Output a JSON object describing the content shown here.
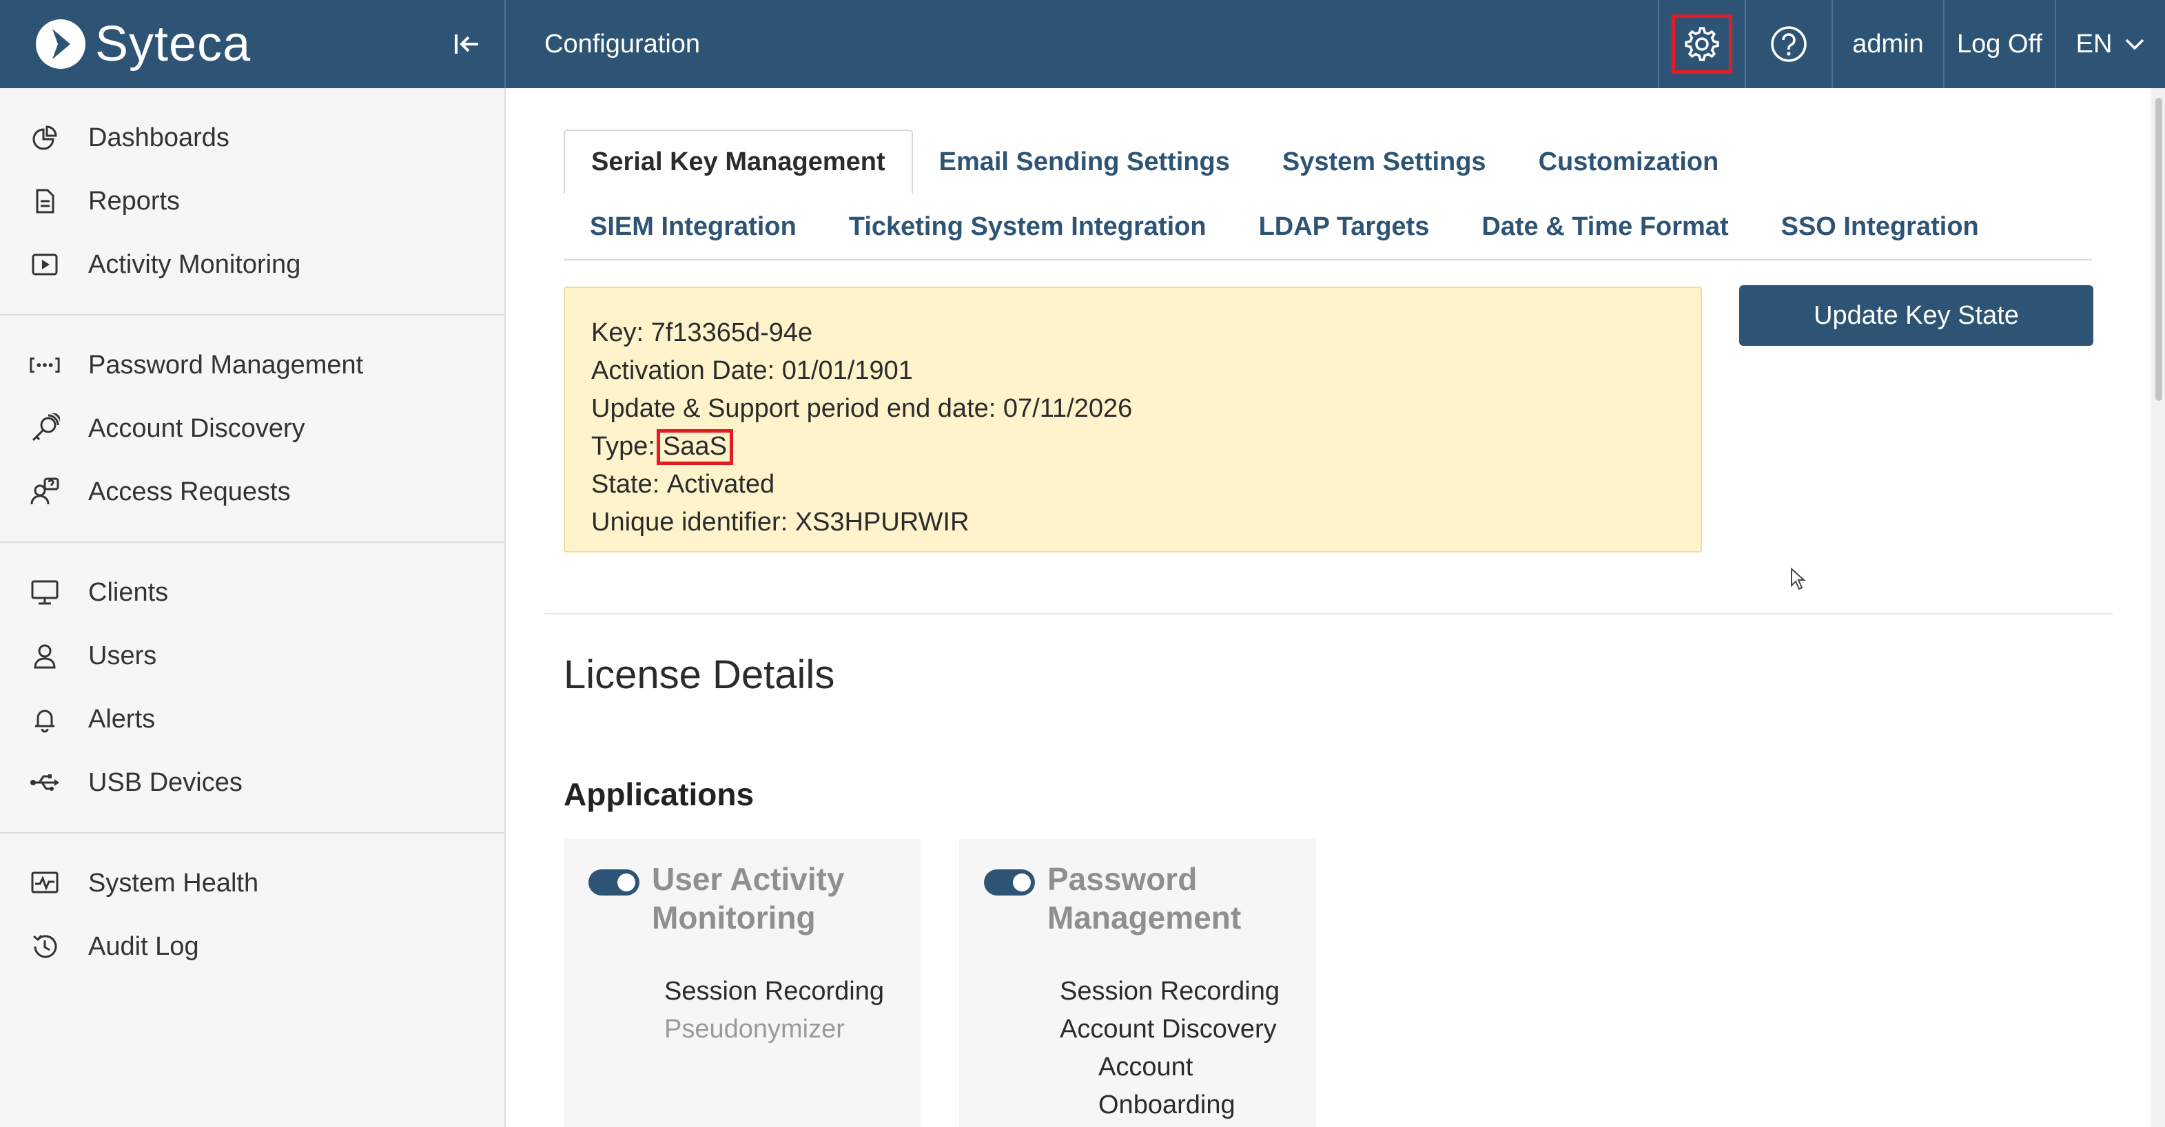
{
  "header": {
    "logo_text": "Syteca",
    "page_title": "Configuration",
    "user": "admin",
    "logoff_label": "Log Off",
    "language": "EN"
  },
  "sidebar": {
    "groups": [
      {
        "items": [
          {
            "label": "Dashboards",
            "icon": "pie-chart-icon"
          },
          {
            "label": "Reports",
            "icon": "document-icon"
          },
          {
            "label": "Activity Monitoring",
            "icon": "play-icon"
          }
        ]
      },
      {
        "items": [
          {
            "label": "Password Management",
            "icon": "password-dots-icon"
          },
          {
            "label": "Account Discovery",
            "icon": "key-search-icon"
          },
          {
            "label": "Access Requests",
            "icon": "user-question-icon"
          }
        ]
      },
      {
        "items": [
          {
            "label": "Clients",
            "icon": "monitor-icon"
          },
          {
            "label": "Users",
            "icon": "user-icon"
          },
          {
            "label": "Alerts",
            "icon": "bell-icon"
          },
          {
            "label": "USB Devices",
            "icon": "usb-icon"
          }
        ]
      },
      {
        "items": [
          {
            "label": "System Health",
            "icon": "pulse-icon"
          },
          {
            "label": "Audit Log",
            "icon": "history-icon"
          }
        ]
      }
    ]
  },
  "tabs": {
    "row1": [
      "Serial Key Management",
      "Email Sending Settings",
      "System Settings",
      "Customization"
    ],
    "row2": [
      "SIEM Integration",
      "Ticketing System Integration",
      "LDAP Targets",
      "Date & Time Format",
      "SSO Integration"
    ],
    "active": "Serial Key Management"
  },
  "key_info": {
    "key_label": "Key:",
    "key_value": "7f13365d-94e",
    "activation_label": "Activation Date:",
    "activation_value": "01/01/1901",
    "support_label": "Update & Support period end date:",
    "support_value": "07/11/2026",
    "type_label": "Type:",
    "type_value": "SaaS",
    "state_label": "State:",
    "state_value": "Activated",
    "uid_label": "Unique identifier:",
    "uid_value": "XS3HPURWIR"
  },
  "update_button": "Update Key State",
  "license": {
    "title": "License Details",
    "applications_title": "Applications",
    "apps": [
      {
        "title_line1": "User Activity",
        "title_line2": "Monitoring",
        "enabled": true,
        "features": [
          {
            "label": "Session Recording",
            "muted": false,
            "sub": false
          },
          {
            "label": "Pseudonymizer",
            "muted": true,
            "sub": false
          }
        ]
      },
      {
        "title_line1": "Password",
        "title_line2": "Management",
        "enabled": true,
        "features": [
          {
            "label": "Session Recording",
            "muted": false,
            "sub": false
          },
          {
            "label": "Account Discovery",
            "muted": false,
            "sub": false
          },
          {
            "label": "Account",
            "muted": false,
            "sub": true
          },
          {
            "label": "Onboarding",
            "muted": false,
            "sub": true
          }
        ]
      }
    ]
  },
  "colors": {
    "brand": "#2e5475",
    "highlight": "#e31b23",
    "panel": "#fff3cc"
  }
}
